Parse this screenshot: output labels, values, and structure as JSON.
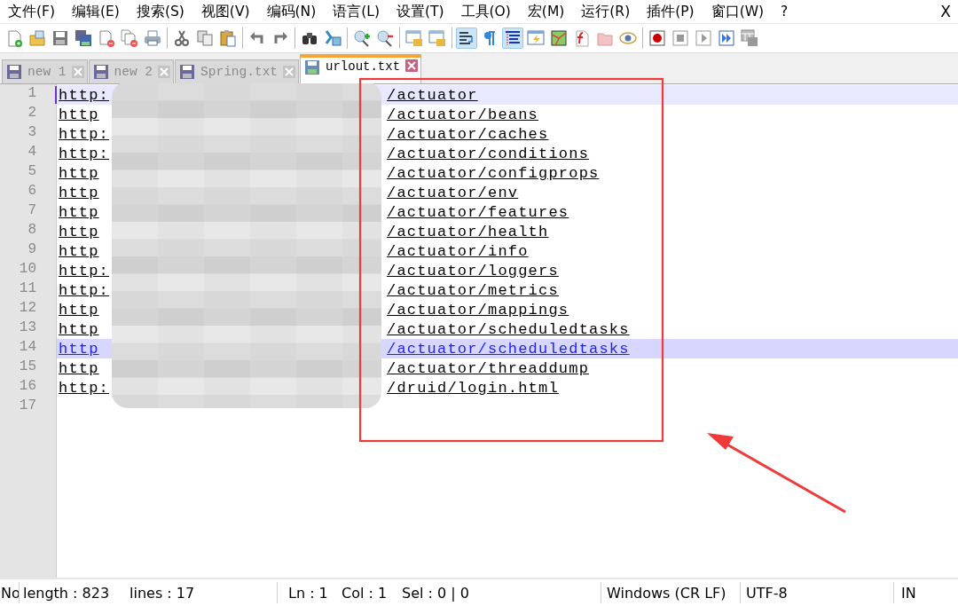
{
  "menu": [
    "文件(F)",
    "编辑(E)",
    "搜索(S)",
    "视图(V)",
    "编码(N)",
    "语言(L)",
    "设置(T)",
    "工具(O)",
    "宏(M)",
    "运行(R)",
    "插件(P)",
    "窗口(W)",
    "?"
  ],
  "close_document": "X",
  "toolbar": [
    [
      {
        "kind": "new",
        "pressed": false
      },
      {
        "kind": "open",
        "pressed": false
      },
      {
        "kind": "save",
        "pressed": false
      },
      {
        "kind": "save-all",
        "pressed": false
      },
      {
        "kind": "close",
        "pressed": false
      },
      {
        "kind": "close-all",
        "pressed": false
      },
      {
        "kind": "print",
        "pressed": false
      }
    ],
    [
      {
        "kind": "cut",
        "pressed": false
      },
      {
        "kind": "copy",
        "pressed": false
      },
      {
        "kind": "paste",
        "pressed": false
      }
    ],
    [
      {
        "kind": "undo",
        "pressed": false
      },
      {
        "kind": "redo",
        "pressed": false
      }
    ],
    [
      {
        "kind": "find",
        "pressed": false
      },
      {
        "kind": "replace",
        "pressed": false
      }
    ],
    [
      {
        "kind": "zoom-in",
        "pressed": false
      },
      {
        "kind": "zoom-out",
        "pressed": false
      }
    ],
    [
      {
        "kind": "sync-v",
        "pressed": false
      },
      {
        "kind": "sync-h",
        "pressed": false
      }
    ],
    [
      {
        "kind": "wrap",
        "pressed": true
      },
      {
        "kind": "pilcrow",
        "pressed": false
      },
      {
        "kind": "indent",
        "pressed": true
      },
      {
        "kind": "udl",
        "pressed": false
      },
      {
        "kind": "map",
        "pressed": false
      },
      {
        "kind": "function",
        "pressed": false
      },
      {
        "kind": "folder",
        "pressed": false
      },
      {
        "kind": "eye",
        "pressed": false
      }
    ],
    [
      {
        "kind": "record",
        "pressed": false
      },
      {
        "kind": "stop",
        "pressed": false
      },
      {
        "kind": "play",
        "pressed": false
      },
      {
        "kind": "play-multi",
        "pressed": false
      },
      {
        "kind": "save-macro",
        "pressed": false
      }
    ]
  ],
  "tabs": [
    {
      "label": "new 1",
      "selected": false
    },
    {
      "label": "new 2",
      "selected": false
    },
    {
      "label": "Spring.txt",
      "selected": false
    },
    {
      "label": "urlout.txt",
      "selected": true
    }
  ],
  "lines": [
    {
      "number": "1",
      "start": "http:",
      "end": "/actuator",
      "current": true,
      "marked": false
    },
    {
      "number": "2",
      "start": "http",
      "end": "/actuator/beans",
      "current": false,
      "marked": false
    },
    {
      "number": "3",
      "start": "http:",
      "end": "/actuator/caches",
      "current": false,
      "marked": false
    },
    {
      "number": "4",
      "start": "http:",
      "end": "/actuator/conditions",
      "current": false,
      "marked": false
    },
    {
      "number": "5",
      "start": "http",
      "end": "/actuator/configprops",
      "current": false,
      "marked": false
    },
    {
      "number": "6",
      "start": "http",
      "end": "/actuator/env",
      "current": false,
      "marked": false
    },
    {
      "number": "7",
      "start": "http",
      "end": "/actuator/features",
      "current": false,
      "marked": false
    },
    {
      "number": "8",
      "start": "http",
      "end": "/actuator/health",
      "current": false,
      "marked": false
    },
    {
      "number": "9",
      "start": "http",
      "end": "/actuator/info",
      "current": false,
      "marked": false
    },
    {
      "number": "10",
      "start": "http:",
      "end": "/actuator/loggers",
      "current": false,
      "marked": false
    },
    {
      "number": "11",
      "start": "http:",
      "end": "/actuator/metrics",
      "current": false,
      "marked": false
    },
    {
      "number": "12",
      "start": "http",
      "end": "/actuator/mappings",
      "current": false,
      "marked": false
    },
    {
      "number": "13",
      "start": "http",
      "end": "/actuator/scheduledtasks",
      "current": false,
      "marked": false
    },
    {
      "number": "14",
      "start": "http",
      "end": "/actuator/scheduledtasks",
      "current": false,
      "marked": true
    },
    {
      "number": "15",
      "start": "http",
      "end": "/actuator/threaddump",
      "current": false,
      "marked": false
    },
    {
      "number": "16",
      "start": "http:",
      "end": "/druid/login.html",
      "current": false,
      "marked": false
    },
    {
      "number": "17",
      "current": false,
      "marked": false
    }
  ],
  "status_bar": {
    "file_type": "No",
    "length": "length : 823",
    "lines": "lines : 17",
    "position": "Ln : 1",
    "column": "Col : 1",
    "selection": "Sel : 0 | 0",
    "eol": "Windows (CR LF)",
    "encoding": "UTF-8",
    "mode": "IN"
  }
}
